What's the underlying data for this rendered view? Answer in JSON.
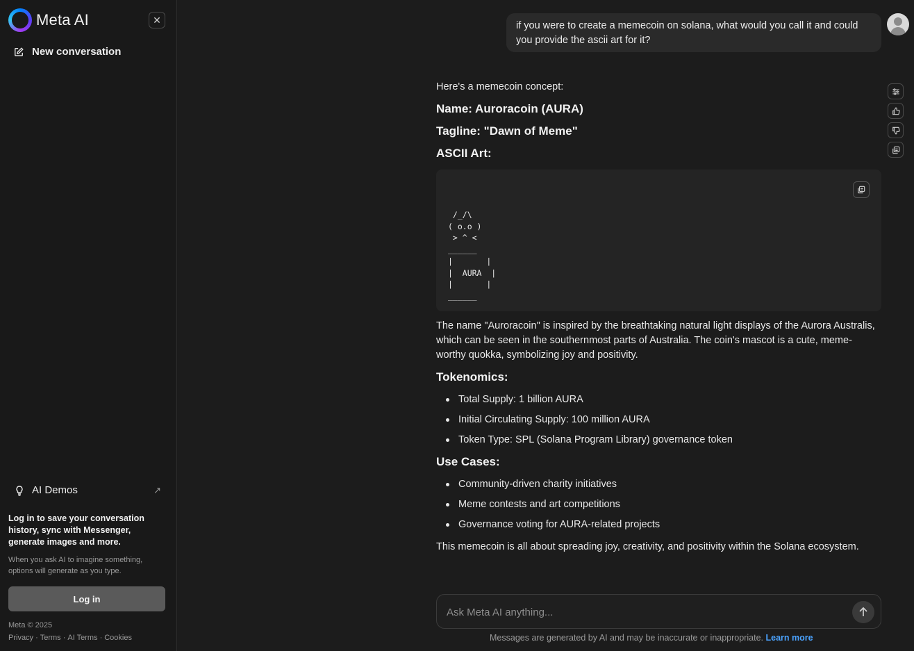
{
  "sidebar": {
    "brand": "Meta AI",
    "new_conversation": "New conversation",
    "ai_demos": "AI Demos",
    "login_title": "Log in to save your conversation history, sync with Messenger, generate images and more.",
    "login_sub": "When you ask AI to imagine something, options will generate as you type.",
    "login_button": "Log in",
    "copyright": "Meta © 2025",
    "links": [
      "Privacy",
      "Terms",
      "AI Terms",
      "Cookies"
    ],
    "link_sep": "·"
  },
  "conversation": {
    "user_message": "if you were to create a memecoin on solana, what would you call it and could you provide the ascii art for it?",
    "intro": "Here's a memecoin concept:",
    "name_line": "Name: Auroracoin (AURA)",
    "tagline_line": "Tagline: \"Dawn of Meme\"",
    "ascii_heading": "ASCII Art:",
    "ascii_art": " /_/\\\n( o.o )\n > ^ <\n______\n|       |\n|  AURA  |\n|       |\n______",
    "description": "The name \"Auroracoin\" is inspired by the breathtaking natural light displays of the Aurora Australis, which can be seen in the southernmost parts of Australia. The coin's mascot is a cute, meme-worthy quokka, symbolizing joy and positivity.",
    "tokenomics_heading": "Tokenomics:",
    "tokenomics": [
      "Total Supply: 1 billion AURA",
      "Initial Circulating Supply: 100 million AURA",
      "Token Type: SPL (Solana Program Library) governance token"
    ],
    "use_cases_heading": "Use Cases:",
    "use_cases": [
      "Community-driven charity initiatives",
      "Meme contests and art competitions",
      "Governance voting for AURA-related projects"
    ],
    "closing": "This memecoin is all about spreading joy, creativity, and positivity within the Solana ecosystem."
  },
  "composer": {
    "placeholder": "Ask Meta AI anything...",
    "disclaimer": "Messages are generated by AI and may be inaccurate or inappropriate.",
    "learn_more": "Learn more"
  },
  "colors": {
    "background": "#1c1c1c",
    "sidebar": "#191919",
    "link": "#4ba3ff"
  }
}
